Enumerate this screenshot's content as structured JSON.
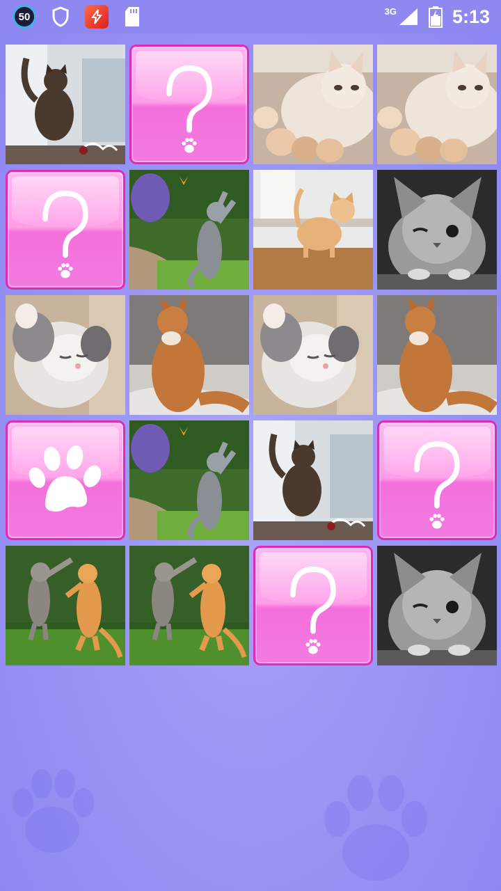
{
  "status_bar": {
    "notification_badge": "50",
    "network": "3G",
    "time": "5:13",
    "icons": [
      "notification-count-icon",
      "shield-icon",
      "flash-app-icon",
      "sd-card-icon",
      "signal-icon",
      "battery-icon"
    ]
  },
  "board": {
    "columns": 4,
    "rows": 5,
    "tiles": [
      {
        "state": "photo",
        "image": "kitten-jumping-splash"
      },
      {
        "state": "hidden",
        "image": "question-mark"
      },
      {
        "state": "photo",
        "image": "cat-nursing-kittens"
      },
      {
        "state": "photo",
        "image": "cat-nursing-kittens"
      },
      {
        "state": "hidden",
        "image": "question-mark"
      },
      {
        "state": "photo",
        "image": "cat-catching-butterfly"
      },
      {
        "state": "photo",
        "image": "orange-cat-looking-up"
      },
      {
        "state": "photo",
        "image": "winking-kitten-bw"
      },
      {
        "state": "photo",
        "image": "fluffy-kitten-sleeping"
      },
      {
        "state": "photo",
        "image": "orange-cat-standing"
      },
      {
        "state": "photo",
        "image": "fluffy-kitten-sleeping"
      },
      {
        "state": "photo",
        "image": "orange-cat-standing"
      },
      {
        "state": "selected",
        "image": "paw"
      },
      {
        "state": "photo",
        "image": "cat-catching-butterfly"
      },
      {
        "state": "photo",
        "image": "kitten-jumping-splash"
      },
      {
        "state": "hidden",
        "image": "question-mark"
      },
      {
        "state": "photo",
        "image": "two-cats-boxing"
      },
      {
        "state": "photo",
        "image": "two-cats-boxing"
      },
      {
        "state": "hidden",
        "image": "question-mark"
      },
      {
        "state": "photo",
        "image": "winking-kitten-bw"
      }
    ]
  },
  "colors": {
    "background": "#9b95f5",
    "card_back": "#ff9de8",
    "card_border": "#e02cb4"
  }
}
